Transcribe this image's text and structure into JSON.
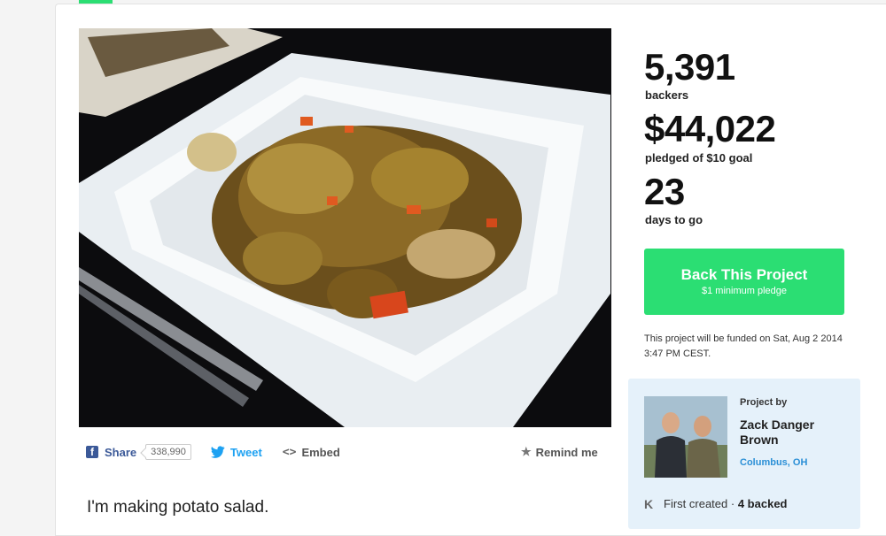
{
  "share": {
    "label": "Share",
    "count": "338,990",
    "tweet_label": "Tweet",
    "embed_label": "Embed",
    "remind_label": "Remind me"
  },
  "blurb": "I'm making potato salad.",
  "stats": {
    "backers_count": "5,391",
    "backers_label": "backers",
    "pledged_amount": "$44,022",
    "pledged_label": "pledged of $10 goal",
    "days_count": "23",
    "days_label": "days to go"
  },
  "back_button": {
    "label": "Back This Project",
    "sub": "$1 minimum pledge"
  },
  "funded_note": "This project will be funded on Sat, Aug 2 2014 3:47 PM CEST.",
  "creator": {
    "project_by_label": "Project by",
    "name": "Zack Danger Brown",
    "location": "Columbus, OH",
    "created_label": "First created",
    "separator": "·",
    "backed_label": "4 backed"
  },
  "colors": {
    "accent": "#2bde73",
    "facebook": "#3b5998",
    "twitter": "#1da1f2",
    "link": "#2a8fd6",
    "creator_bg": "#e5f1fa"
  },
  "icons": {
    "facebook": "facebook-icon",
    "twitter": "twitter-icon",
    "embed": "embed-icon",
    "star": "star-icon",
    "kickstarter": "kickstarter-k-icon"
  }
}
